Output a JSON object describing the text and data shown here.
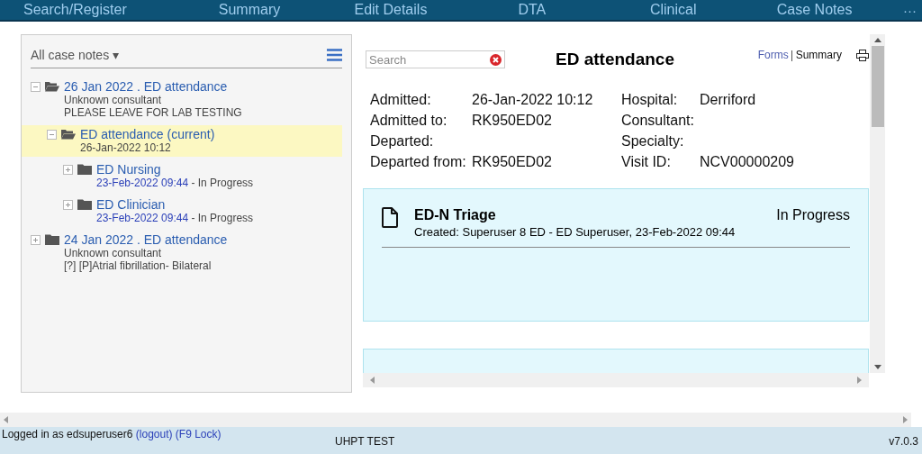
{
  "nav": {
    "items": [
      {
        "label": "Search/Register"
      },
      {
        "label": "Summary"
      },
      {
        "label": "Edit Details"
      },
      {
        "label": "DTA"
      },
      {
        "label": "Clinical"
      },
      {
        "label": "Case Notes"
      }
    ],
    "more": "···"
  },
  "sidebar": {
    "filter": "All case notes",
    "caret": "▾",
    "tree": [
      {
        "title": "26 Jan 2022 . ED attendance",
        "lines": [
          "Unknown consultant",
          "PLEASE LEAVE FOR LAB TESTING"
        ],
        "expanded": true,
        "selected": false,
        "children": [
          {
            "title": "ED attendance (current)",
            "lines": [
              "26-Jan-2022 10:12"
            ],
            "expanded": true,
            "selected": true,
            "children": [
              {
                "title": "ED Nursing",
                "date": "23-Feb-2022 09:44",
                "status": "- In Progress",
                "expanded": false,
                "selected": false
              },
              {
                "title": "ED Clinician",
                "date": "23-Feb-2022 09:44",
                "status": "- In Progress",
                "expanded": false,
                "selected": false
              }
            ]
          }
        ]
      },
      {
        "title": "24 Jan 2022 . ED attendance",
        "lines": [
          "Unknown consultant",
          "[?] [P]Atrial fibrillation- Bilateral"
        ],
        "expanded": false,
        "selected": false
      }
    ]
  },
  "detail": {
    "search": {
      "placeholder": "Search"
    },
    "title": "ED attendance",
    "links": [
      {
        "label": "Forms",
        "selected": false
      },
      {
        "label": "Summary",
        "selected": true
      }
    ],
    "fields": [
      [
        {
          "label": "Admitted:",
          "value": "26-Jan-2022 10:12"
        },
        {
          "label": "Hospital:",
          "value": "Derriford"
        }
      ],
      [
        {
          "label": "Admitted to:",
          "value": "RK950ED02"
        },
        {
          "label": "Consultant:"
        }
      ],
      [
        {
          "label": "Departed:"
        },
        {
          "label": "Specialty:"
        }
      ],
      [
        {
          "label": "Departed from:",
          "value": "RK950ED02"
        },
        {
          "label": "Visit ID:",
          "value": "NCV00000209"
        }
      ]
    ],
    "cards": [
      {
        "title": "ED-N Triage",
        "status": "In Progress",
        "created": "Created: Superuser 8 ED - ED Superuser, 23-Feb-2022 09:44",
        "cut": false
      },
      {
        "cut": true
      }
    ]
  },
  "status_bar": {
    "user": "Logged in as edsuperuser6",
    "logout": "(logout)",
    "lock": "(F9 Lock)",
    "env": "UHPT TEST",
    "version": "v7.0.3"
  }
}
